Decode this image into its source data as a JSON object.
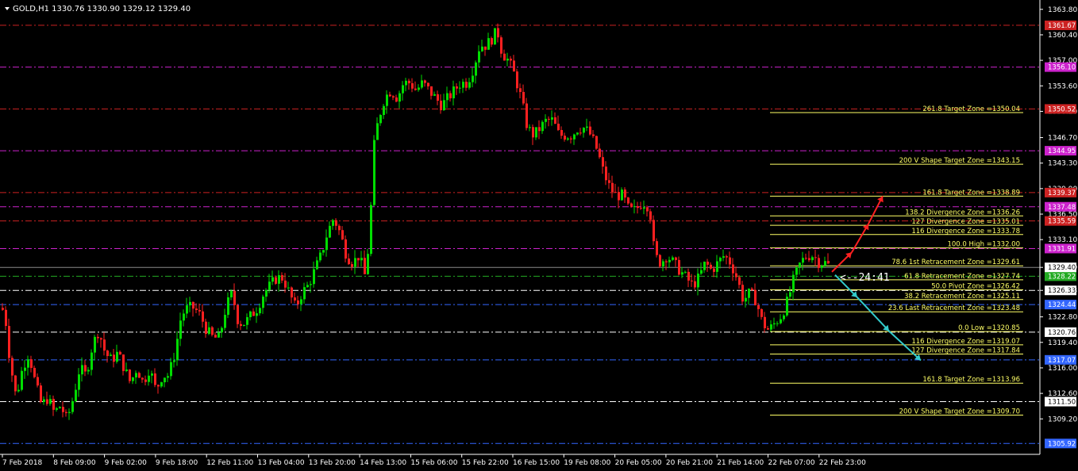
{
  "symbol_header": "GOLD,H1  1330.76 1330.90 1329.12 1329.40",
  "countdown": "<--24:41",
  "chart_data": {
    "type": "candlestick",
    "title": "GOLD,H1",
    "ohlc_header": {
      "open": 1330.76,
      "high": 1330.9,
      "low": 1329.12,
      "close": 1329.4
    },
    "y_range": [
      1305.0,
      1364.2
    ],
    "y_ticks": [
      "1363.80",
      "1360.40",
      "1357.00",
      "1353.60",
      "1350.20",
      "1346.70",
      "1343.30",
      "1339.90",
      "1336.50",
      "1333.10",
      "1329.40",
      "1326.33",
      "1322.80",
      "1319.40",
      "1316.00",
      "1312.60",
      "1309.20"
    ],
    "x_tick_labels": [
      "7 Feb 2018",
      "8 Feb 09:00",
      "9 Feb 02:00",
      "9 Feb 18:00",
      "12 Feb 11:00",
      "13 Feb 04:00",
      "13 Feb 20:00",
      "14 Feb 13:00",
      "15 Feb 06:00",
      "15 Feb 22:00",
      "16 Feb 15:00",
      "19 Feb 08:00",
      "20 Feb 05:00",
      "20 Feb 21:00",
      "21 Feb 14:00",
      "22 Feb 07:00",
      "22 Feb 23:00"
    ],
    "current_price": "1329.40",
    "price_path": [
      [
        0,
        1324.5
      ],
      [
        6,
        1323
      ],
      [
        12,
        1317
      ],
      [
        20,
        1312
      ],
      [
        28,
        1316
      ],
      [
        36,
        1318
      ],
      [
        44,
        1314
      ],
      [
        52,
        1311
      ],
      [
        60,
        1312
      ],
      [
        68,
        1310
      ],
      [
        76,
        1311
      ],
      [
        84,
        1309
      ],
      [
        92,
        1312
      ],
      [
        100,
        1316
      ],
      [
        108,
        1315
      ],
      [
        116,
        1319
      ],
      [
        124,
        1321
      ],
      [
        132,
        1318
      ],
      [
        140,
        1317
      ],
      [
        148,
        1318
      ],
      [
        156,
        1316
      ],
      [
        164,
        1314
      ],
      [
        172,
        1316
      ],
      [
        180,
        1314
      ],
      [
        188,
        1316
      ],
      [
        196,
        1313
      ],
      [
        204,
        1315
      ],
      [
        212,
        1315
      ],
      [
        220,
        1318
      ],
      [
        228,
        1323
      ],
      [
        236,
        1324
      ],
      [
        244,
        1324
      ],
      [
        252,
        1323
      ],
      [
        260,
        1321
      ],
      [
        268,
        1320
      ],
      [
        276,
        1320
      ],
      [
        284,
        1324
      ],
      [
        292,
        1326
      ],
      [
        300,
        1322
      ],
      [
        308,
        1322
      ],
      [
        316,
        1323
      ],
      [
        324,
        1324
      ],
      [
        332,
        1326
      ],
      [
        340,
        1327
      ],
      [
        348,
        1328
      ],
      [
        356,
        1328
      ],
      [
        364,
        1326
      ],
      [
        372,
        1324
      ],
      [
        380,
        1326
      ],
      [
        388,
        1327
      ],
      [
        396,
        1329
      ],
      [
        404,
        1331
      ],
      [
        412,
        1334
      ],
      [
        420,
        1336
      ],
      [
        428,
        1334
      ],
      [
        436,
        1331
      ],
      [
        444,
        1330
      ],
      [
        452,
        1331
      ],
      [
        460,
        1328
      ],
      [
        466,
        1335
      ],
      [
        470,
        1345
      ],
      [
        476,
        1349
      ],
      [
        484,
        1352
      ],
      [
        492,
        1353
      ],
      [
        500,
        1352
      ],
      [
        508,
        1354
      ],
      [
        516,
        1354
      ],
      [
        524,
        1353
      ],
      [
        532,
        1354
      ],
      [
        540,
        1353
      ],
      [
        548,
        1352
      ],
      [
        556,
        1351
      ],
      [
        564,
        1352
      ],
      [
        572,
        1353
      ],
      [
        580,
        1354
      ],
      [
        588,
        1354
      ],
      [
        596,
        1356
      ],
      [
        604,
        1359
      ],
      [
        612,
        1359
      ],
      [
        620,
        1360
      ],
      [
        626,
        1361
      ],
      [
        632,
        1358
      ],
      [
        640,
        1357
      ],
      [
        648,
        1355
      ],
      [
        656,
        1352
      ],
      [
        664,
        1348
      ],
      [
        672,
        1347
      ],
      [
        680,
        1348
      ],
      [
        688,
        1349
      ],
      [
        696,
        1349
      ],
      [
        704,
        1347
      ],
      [
        712,
        1347
      ],
      [
        720,
        1347
      ],
      [
        728,
        1348
      ],
      [
        736,
        1348
      ],
      [
        744,
        1347
      ],
      [
        752,
        1345
      ],
      [
        760,
        1342
      ],
      [
        768,
        1340
      ],
      [
        776,
        1339
      ],
      [
        784,
        1339
      ],
      [
        792,
        1337
      ],
      [
        800,
        1337
      ],
      [
        808,
        1338
      ],
      [
        814,
        1338
      ],
      [
        820,
        1336
      ],
      [
        824,
        1331
      ],
      [
        832,
        1330
      ],
      [
        840,
        1331
      ],
      [
        848,
        1330
      ],
      [
        856,
        1329
      ],
      [
        864,
        1328
      ],
      [
        872,
        1327
      ],
      [
        880,
        1328
      ],
      [
        888,
        1330
      ],
      [
        896,
        1329
      ],
      [
        904,
        1330
      ],
      [
        912,
        1331
      ],
      [
        920,
        1330
      ],
      [
        928,
        1328
      ],
      [
        936,
        1325
      ],
      [
        944,
        1326
      ],
      [
        952,
        1325
      ],
      [
        960,
        1322
      ],
      [
        968,
        1321
      ],
      [
        976,
        1322
      ],
      [
        984,
        1323
      ],
      [
        992,
        1325
      ],
      [
        1000,
        1328
      ],
      [
        1008,
        1330
      ],
      [
        1016,
        1331
      ],
      [
        1024,
        1331
      ],
      [
        1032,
        1330
      ],
      [
        1040,
        1330
      ],
      [
        1046,
        1329.4
      ]
    ],
    "level_lines": [
      {
        "price": 1361.67,
        "label": "1361.67",
        "color": "#cc2222",
        "style": "dashdot"
      },
      {
        "price": 1356.1,
        "label": "1356.10",
        "color": "#cc22cc",
        "style": "dashdot"
      },
      {
        "price": 1350.52,
        "label": "1350.52",
        "color": "#cc2222",
        "style": "dashdot"
      },
      {
        "price": 1344.95,
        "label": "1344.95",
        "color": "#cc22cc",
        "style": "dashdot"
      },
      {
        "price": 1339.37,
        "label": "1339.37",
        "color": "#cc2222",
        "style": "dashdot"
      },
      {
        "price": 1337.48,
        "label": "1337.48",
        "color": "#cc22cc",
        "style": "dashdot"
      },
      {
        "price": 1335.59,
        "label": "1335.59",
        "color": "#cc2222",
        "style": "dashdot"
      },
      {
        "price": 1331.91,
        "label": "1331.91",
        "color": "#cc22cc",
        "style": "dashdot"
      },
      {
        "price": 1328.22,
        "label": "1328.22",
        "color": "#22aa22",
        "style": "dashdot"
      },
      {
        "price": 1326.33,
        "label": "1326.33",
        "color": "#ffffff",
        "style": "dashdot"
      },
      {
        "price": 1324.44,
        "label": "1324.44",
        "color": "#3366ff",
        "style": "dashdot"
      },
      {
        "price": 1320.76,
        "label": "1320.76",
        "color": "#ffffff",
        "style": "dashdot"
      },
      {
        "price": 1317.07,
        "label": "1317.07",
        "color": "#3366ff",
        "style": "dashdot"
      },
      {
        "price": 1311.5,
        "label": "1311.50",
        "color": "#ffffff",
        "style": "dashdot"
      },
      {
        "price": 1305.92,
        "label": "1305.92",
        "color": "#3366ff",
        "style": "dashdot"
      }
    ],
    "target_zones": [
      {
        "price": 1350.04,
        "label": "261.8 Target Zone =1350.04"
      },
      {
        "price": 1343.15,
        "label": "200 V Shape Target Zone =1343.15"
      },
      {
        "price": 1338.89,
        "label": "161.8 Target Zone =1338.89"
      },
      {
        "price": 1336.26,
        "label": "138.2 Divergence Zone =1336.26"
      },
      {
        "price": 1335.01,
        "label": "127 Divergence Zone =1335.01"
      },
      {
        "price": 1333.78,
        "label": "116 Divergence Zone =1333.78"
      },
      {
        "price": 1332.0,
        "label": "100.0 High =1332.00"
      },
      {
        "price": 1329.61,
        "label": "78.6 1st Retracement Zone =1329.61"
      },
      {
        "price": 1327.74,
        "label": "61.8 Retracement Zone =1327.74"
      },
      {
        "price": 1326.42,
        "label": "50.0 Pivot Zone =1326.42"
      },
      {
        "price": 1325.11,
        "label": "38.2 Retracement Zone =1325.11"
      },
      {
        "price": 1323.48,
        "label": "23.6 Last Retracement Zone =1323.48"
      },
      {
        "price": 1320.85,
        "label": "0.0 Low =1320.85"
      },
      {
        "price": 1319.07,
        "label": "116 Divergence Zone =1319.07"
      },
      {
        "price": 1317.84,
        "label": "127 Divergence Zone =1317.84"
      },
      {
        "price": 1313.96,
        "label": "161.8 Target Zone =1313.96"
      },
      {
        "price": 1309.7,
        "label": "200  V Shape Target Zone =1309.70"
      }
    ],
    "projection_up": {
      "color": "#ff2020",
      "points": [
        [
          1048,
          1328.8
        ],
        [
          1073,
          1331.4
        ],
        [
          1094,
          1335.2
        ],
        [
          1112,
          1338.9
        ]
      ]
    },
    "projection_down": {
      "color": "#33cccc",
      "points": [
        [
          1052,
          1328.4
        ],
        [
          1080,
          1325.4
        ],
        [
          1120,
          1320.9
        ],
        [
          1160,
          1317.0
        ]
      ]
    },
    "colors": {
      "bull": "#00dd00",
      "bear": "#ff2020",
      "target": "#ffff66",
      "axis": "#ffffff",
      "price_badge": "#ffffff"
    }
  }
}
